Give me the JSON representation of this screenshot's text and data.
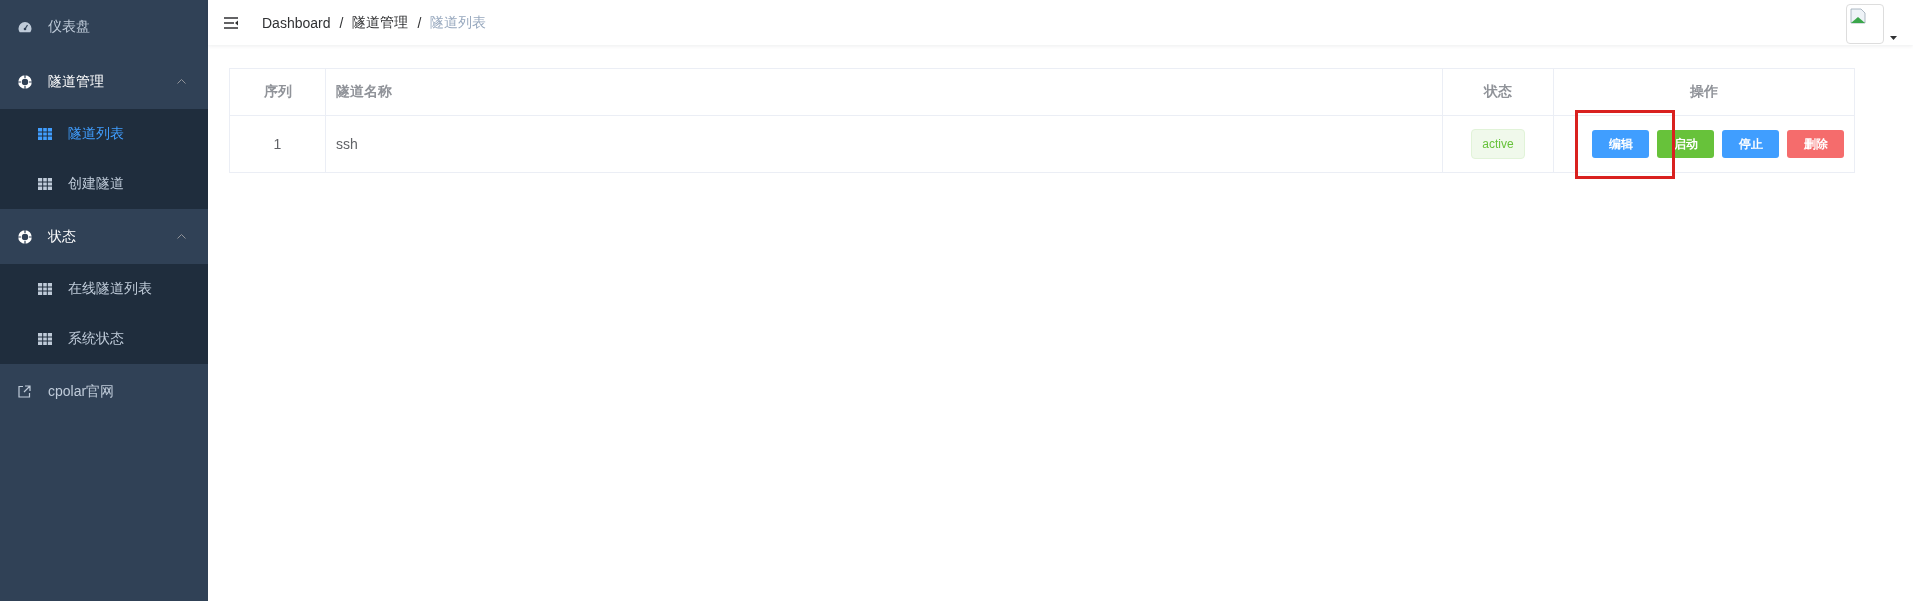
{
  "sidebar": {
    "items": [
      {
        "kind": "item",
        "label": "仪表盘",
        "selected": false
      },
      {
        "kind": "group",
        "label": "隧道管理",
        "expanded": true,
        "children": [
          {
            "label": "隧道列表",
            "selected": true
          },
          {
            "label": "创建隧道",
            "selected": false
          }
        ]
      },
      {
        "kind": "group",
        "label": "状态",
        "expanded": true,
        "children": [
          {
            "label": "在线隧道列表",
            "selected": false
          },
          {
            "label": "系统状态",
            "selected": false
          }
        ]
      },
      {
        "kind": "link",
        "label": "cpolar官网",
        "selected": false
      }
    ]
  },
  "header": {
    "breadcrumb": [
      "Dashboard",
      "隧道管理",
      "隧道列表"
    ],
    "separator": "/"
  },
  "table": {
    "columns": [
      "序列",
      "隧道名称",
      "状态",
      "操作"
    ],
    "rows": [
      {
        "index": "1",
        "name": "ssh",
        "status": "active",
        "actions": [
          {
            "label": "编辑",
            "kind": "primary"
          },
          {
            "label": "启动",
            "kind": "success"
          },
          {
            "label": "停止",
            "kind": "primary"
          },
          {
            "label": "删除",
            "kind": "danger"
          }
        ]
      }
    ]
  },
  "annotation": {
    "kind": "highlight-box"
  }
}
